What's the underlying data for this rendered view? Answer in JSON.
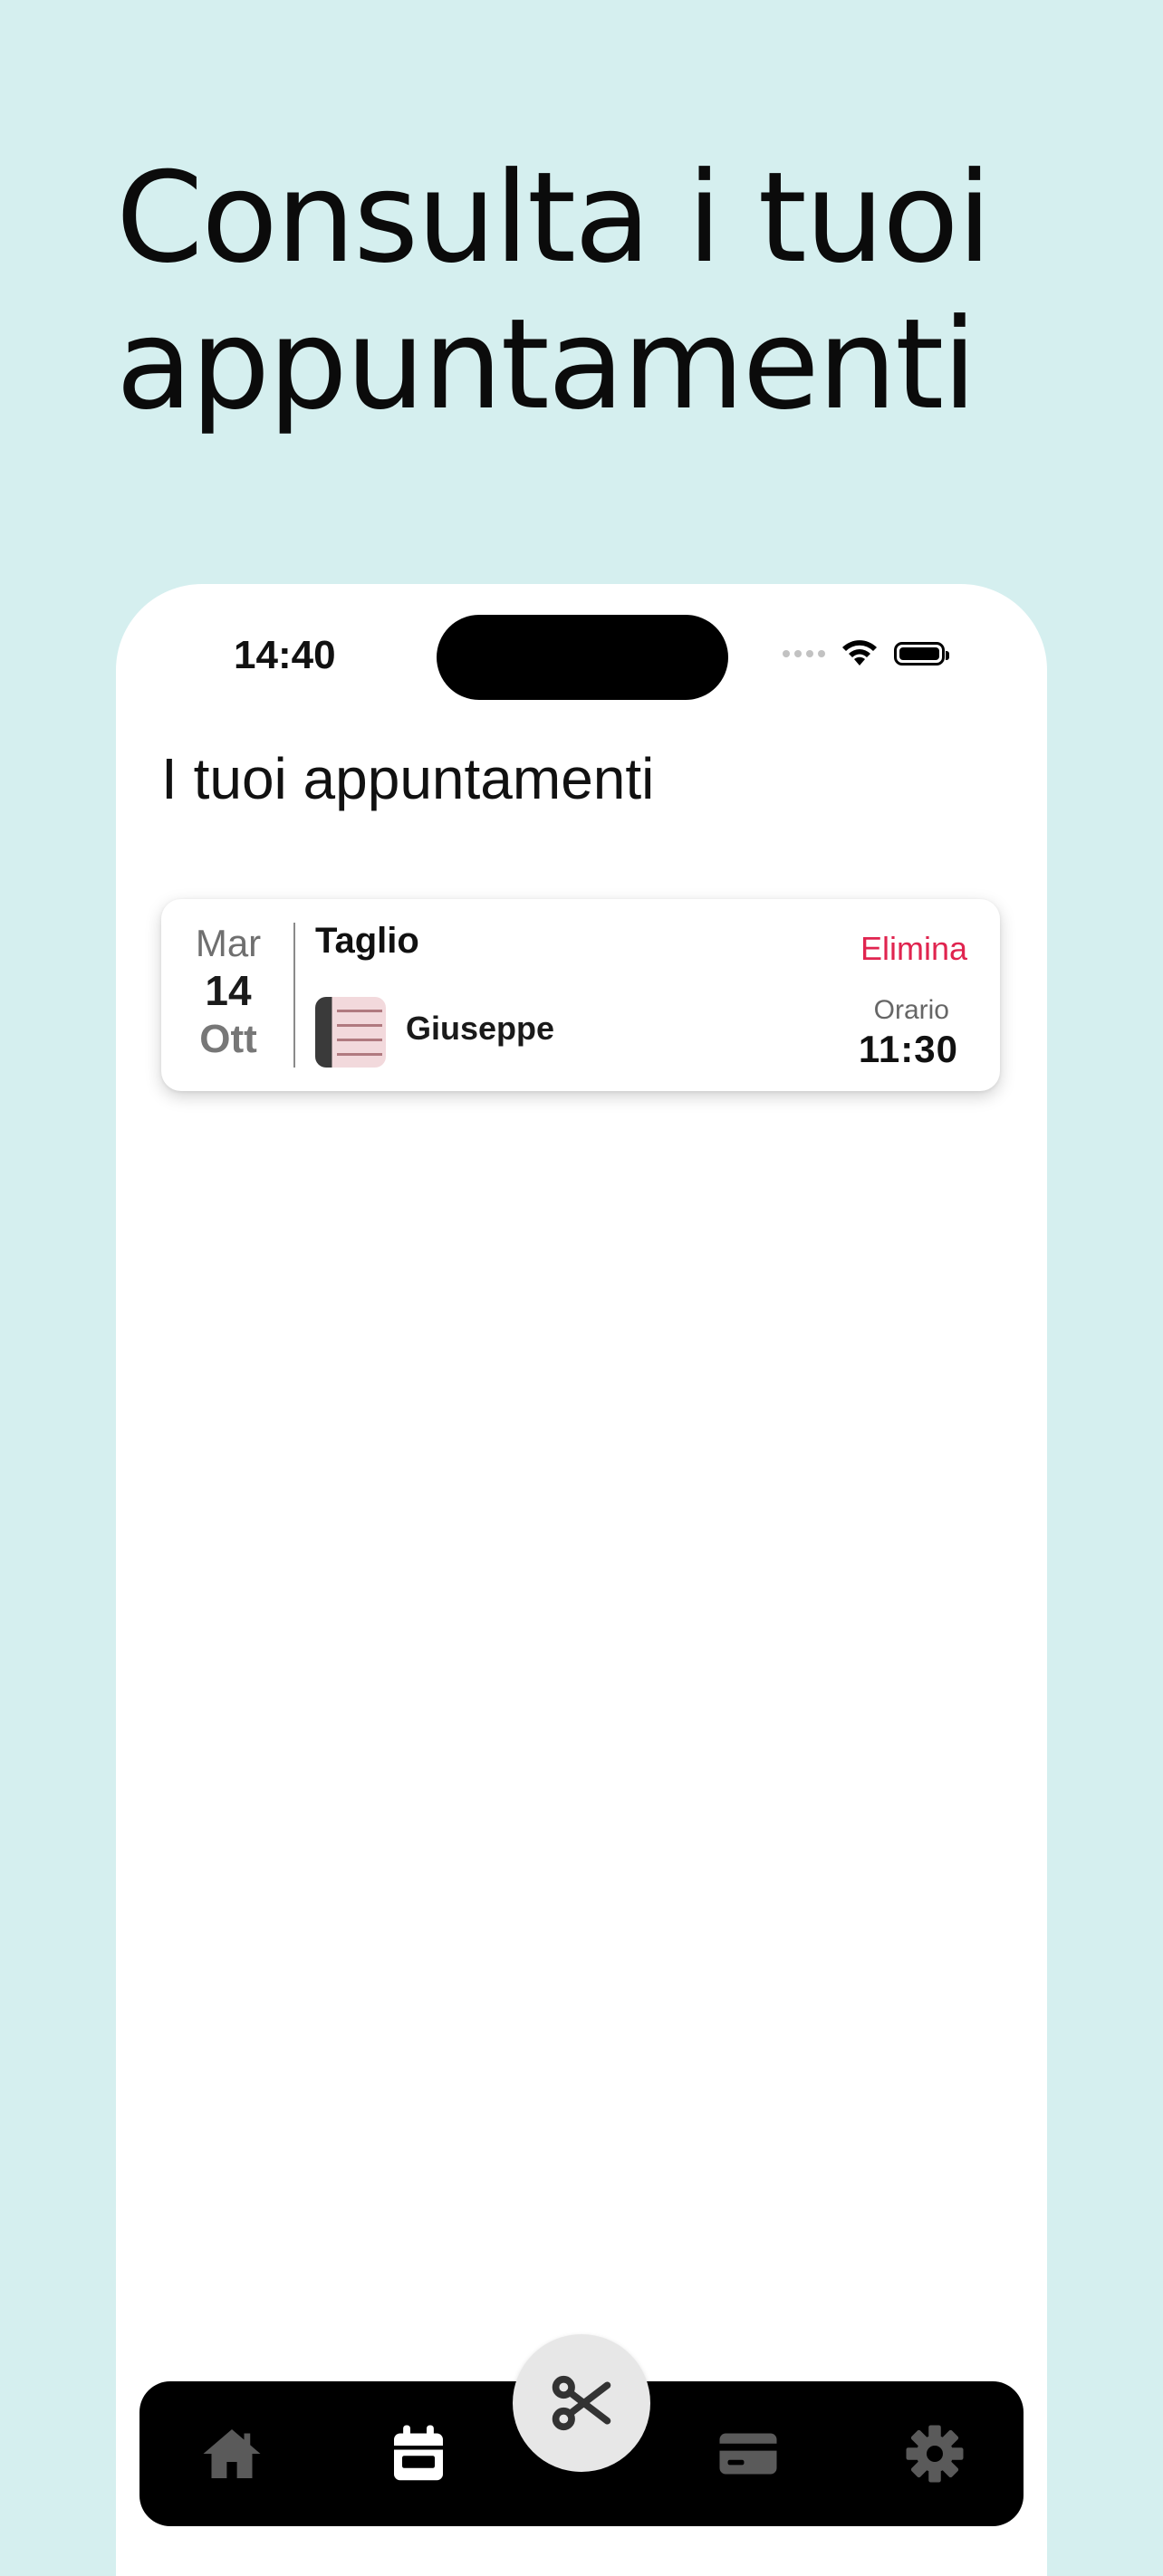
{
  "hero": {
    "title": "Consulta i tuoi appuntamenti"
  },
  "status_bar": {
    "time": "14:40"
  },
  "page": {
    "heading": "I tuoi appuntamenti"
  },
  "appointments": [
    {
      "day_of_week": "Mar",
      "day": "14",
      "month": "Ott",
      "service": "Taglio",
      "barber": "Giuseppe",
      "delete_label": "Elimina",
      "time_label": "Orario",
      "time": "11:30"
    }
  ],
  "tab_bar": {
    "items": [
      {
        "icon": "home-icon",
        "active": false
      },
      {
        "icon": "calendar-icon",
        "active": true
      },
      {
        "icon": "scissors-icon",
        "active": false,
        "center": true
      },
      {
        "icon": "credit-card-icon",
        "active": false
      },
      {
        "icon": "gear-icon",
        "active": false
      }
    ]
  },
  "colors": {
    "background": "#d5efef",
    "delete": "#e0244f",
    "tab_bar": "#000000",
    "tab_icon_inactive": "#5a5a5a",
    "tab_icon_active": "#ffffff"
  }
}
